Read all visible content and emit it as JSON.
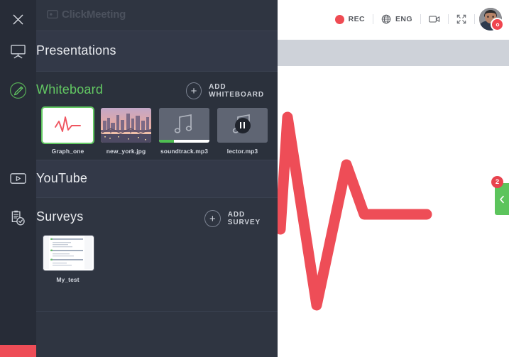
{
  "app": {
    "logo_text": "ClickMeeting"
  },
  "topbar": {
    "rec_label": "REC",
    "lang_label": "ENG",
    "rec_icon": "record-dot-icon",
    "globe_icon": "globe-icon",
    "camera_icon": "camera-icon",
    "fullscreen_icon": "fullscreen-icon",
    "avatar_icon": "user-avatar",
    "avatar_badge_icon": "settings-gear-icon"
  },
  "side_tab": {
    "badge_count": "2",
    "chevron_icon": "chevron-left-icon"
  },
  "panel": {
    "close_icon": "close-icon",
    "sections": [
      {
        "id": "presentations",
        "title": "Presentations",
        "icon": "presentation-screen-icon",
        "active": false,
        "action": null
      },
      {
        "id": "whiteboard",
        "title": "Whiteboard",
        "icon": "pencil-circle-icon",
        "active": true,
        "action": {
          "label": "ADD WHITEBOARD",
          "icon": "plus-circle-icon"
        },
        "items": [
          {
            "name": "Graph_one",
            "type": "whiteboard",
            "selected": true
          },
          {
            "name": "new_york.jpg",
            "type": "image",
            "selected": false
          },
          {
            "name": "soundtrack.mp3",
            "type": "audio",
            "selected": false,
            "progress": 30
          },
          {
            "name": "lector.mp3",
            "type": "audio",
            "selected": false,
            "playing": true
          }
        ]
      },
      {
        "id": "youtube",
        "title": "YouTube",
        "icon": "youtube-play-icon",
        "active": false,
        "action": null
      },
      {
        "id": "surveys",
        "title": "Surveys",
        "icon": "clipboard-check-icon",
        "active": false,
        "action": {
          "label": "ADD SURVEY",
          "icon": "plus-circle-icon"
        },
        "items": [
          {
            "name": "My_test",
            "type": "survey",
            "selected": false
          }
        ]
      }
    ]
  },
  "canvas": {
    "content_icon": "pulse-line-drawing",
    "stroke_color": "#ee4d57"
  },
  "colors": {
    "panel_bg": "#2f3541",
    "rail_bg": "#272c37",
    "accent_green": "#63c963",
    "accent_red": "#ee4d57",
    "band_gray": "#ced2d9"
  }
}
